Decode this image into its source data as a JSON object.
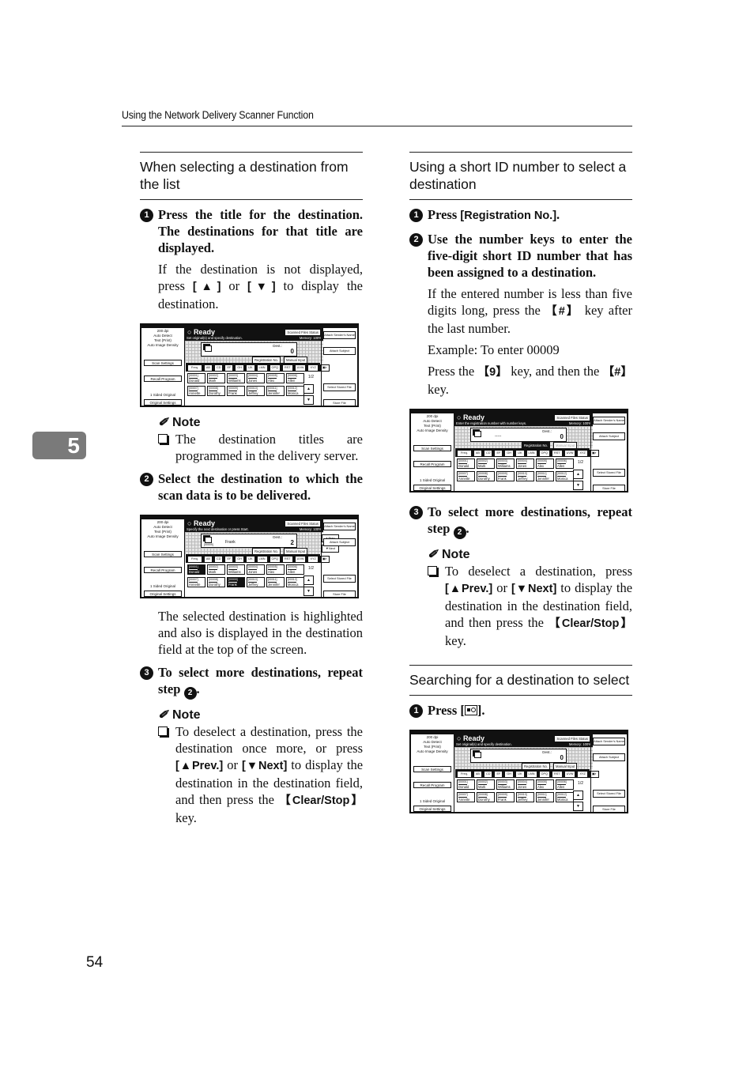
{
  "header": {
    "running_title": "Using the Network Delivery Scanner Function"
  },
  "chapter_tab": "5",
  "page_number": "54",
  "left": {
    "section_title": "When selecting a destination from the list",
    "step1": {
      "num": "1",
      "title": "Press the title for the destination. The destinations for that title are displayed.",
      "body_pre": "If the destination is not displayed, press ",
      "key_up": "[▲]",
      "body_mid": " or ",
      "key_down": "[▼]",
      "body_post": " to display the destination."
    },
    "note1": {
      "title": "Note",
      "item": "The destination titles are programmed in the delivery server."
    },
    "step2": {
      "num": "2",
      "title": "Select the destination to which the scan data is to be delivered.",
      "body": "The selected destination is highlighted and also is displayed in the destination field at the top of the screen."
    },
    "step3": {
      "num": "3",
      "title_pre": "To select more destinations, repeat step ",
      "ref": "2",
      "title_post": "."
    },
    "note2": {
      "title": "Note",
      "pre": "To deselect a destination, press the destination once more, or press ",
      "key_prev": "[▲Prev.]",
      "mid": " or ",
      "key_next": "[▼Next]",
      "post1": " to display the destination in the destination field, and then press the ",
      "key_clear": "【Clear/Stop】",
      "post2": " key."
    }
  },
  "right": {
    "section_title": "Using a short ID number to select a destination",
    "step1": {
      "num": "1",
      "pre": "Press ",
      "key": "[Registration No.]",
      "post": "."
    },
    "step2": {
      "num": "2",
      "title": "Use the number keys to enter the five-digit short ID number that has been assigned to a destination.",
      "body1_pre": "If the entered number is less than five digits long, press the ",
      "key_hash": "【#】",
      "body1_post": " key after the last number.",
      "example": "Example: To enter 00009",
      "body2_pre": "Press the ",
      "key_9": "【9】",
      "body2_mid": " key, and then the ",
      "key_hash2": "【#】",
      "body2_post": " key."
    },
    "step3": {
      "num": "3",
      "title_pre": "To select more destinations, repeat step ",
      "ref": "2",
      "title_post": "."
    },
    "note": {
      "title": "Note",
      "pre": "To deselect a destination, press ",
      "key_prev": "[▲Prev.]",
      "mid": " or ",
      "key_next": "[▼Next]",
      "post1": " to display the destination in the destination field, and then press the ",
      "key_clear": "【Clear/Stop】",
      "post2": " key."
    },
    "section2_title": "Searching for a destination to select",
    "search_step1": {
      "num": "1",
      "pre": "Press [",
      "icon": "search-destination-icon",
      "post": "]."
    }
  },
  "screens": {
    "common": {
      "info_lines": [
        "200 dpi",
        "Auto Detect",
        "Text (Print)",
        "Auto Image Density"
      ],
      "scan_settings": "Scan Settings",
      "recall_program": "Recall Program",
      "original_label": "1 Sided Original",
      "original_settings": "Original Settings",
      "ready": "Ready",
      "status_button": "Scanned Files Status",
      "memory": "Memory: 100%",
      "dest_label": "Dest.:",
      "registration_no": "Registration No.",
      "manual_input": "Manual Input",
      "attach_sender": "Attach Sender's Name",
      "attach_subject": "Attach Subject",
      "select_stored": "Select Stored File",
      "store_file": "Store File",
      "tabs": [
        "Freq.",
        "AB",
        "CD",
        "EF",
        "GH",
        "IJK",
        "LMN",
        "OPQ",
        "RST",
        "UVW",
        "XYZ"
      ],
      "page_indicator": "1/2",
      "prev": "▲Prev.",
      "next": "▼Next",
      "destinations": [
        {
          "code": "[00001]",
          "name": "Donald"
        },
        {
          "code": "[00002]",
          "name": "Mark"
        },
        {
          "code": "[00003]",
          "name": "Williams"
        },
        {
          "code": "[00004]",
          "name": "Jones"
        },
        {
          "code": "[00005]",
          "name": "Alex"
        },
        {
          "code": "[00006]",
          "name": "Allen"
        },
        {
          "code": "[00007]",
          "name": "Annette"
        },
        {
          "code": "[00008]",
          "name": "Dorothy"
        },
        {
          "code": "[00009]",
          "name": "Frank"
        },
        {
          "code": "[00010]",
          "name": "Jeffrey"
        },
        {
          "code": "[00011]",
          "name": "Jennifer"
        },
        {
          "code": "[00012]",
          "name": "Monica"
        }
      ]
    },
    "screen1": {
      "message": "Set original(s) and specify destination.",
      "dest_count": "0",
      "dest_name": ""
    },
    "screen2": {
      "message": "Specify the next destination or press Start.",
      "dest_count": "2",
      "dest_name": "Frank",
      "dest_code": "[00009]",
      "selected": [
        "Donald",
        "Frank"
      ]
    },
    "screen3": {
      "message": "Enter the registration number with number keys.",
      "dest_count": "0",
      "dest_name": "-----"
    },
    "screen4": {
      "message": "Set original(s) and specify destination.",
      "dest_count": "0",
      "dest_name": ""
    }
  }
}
